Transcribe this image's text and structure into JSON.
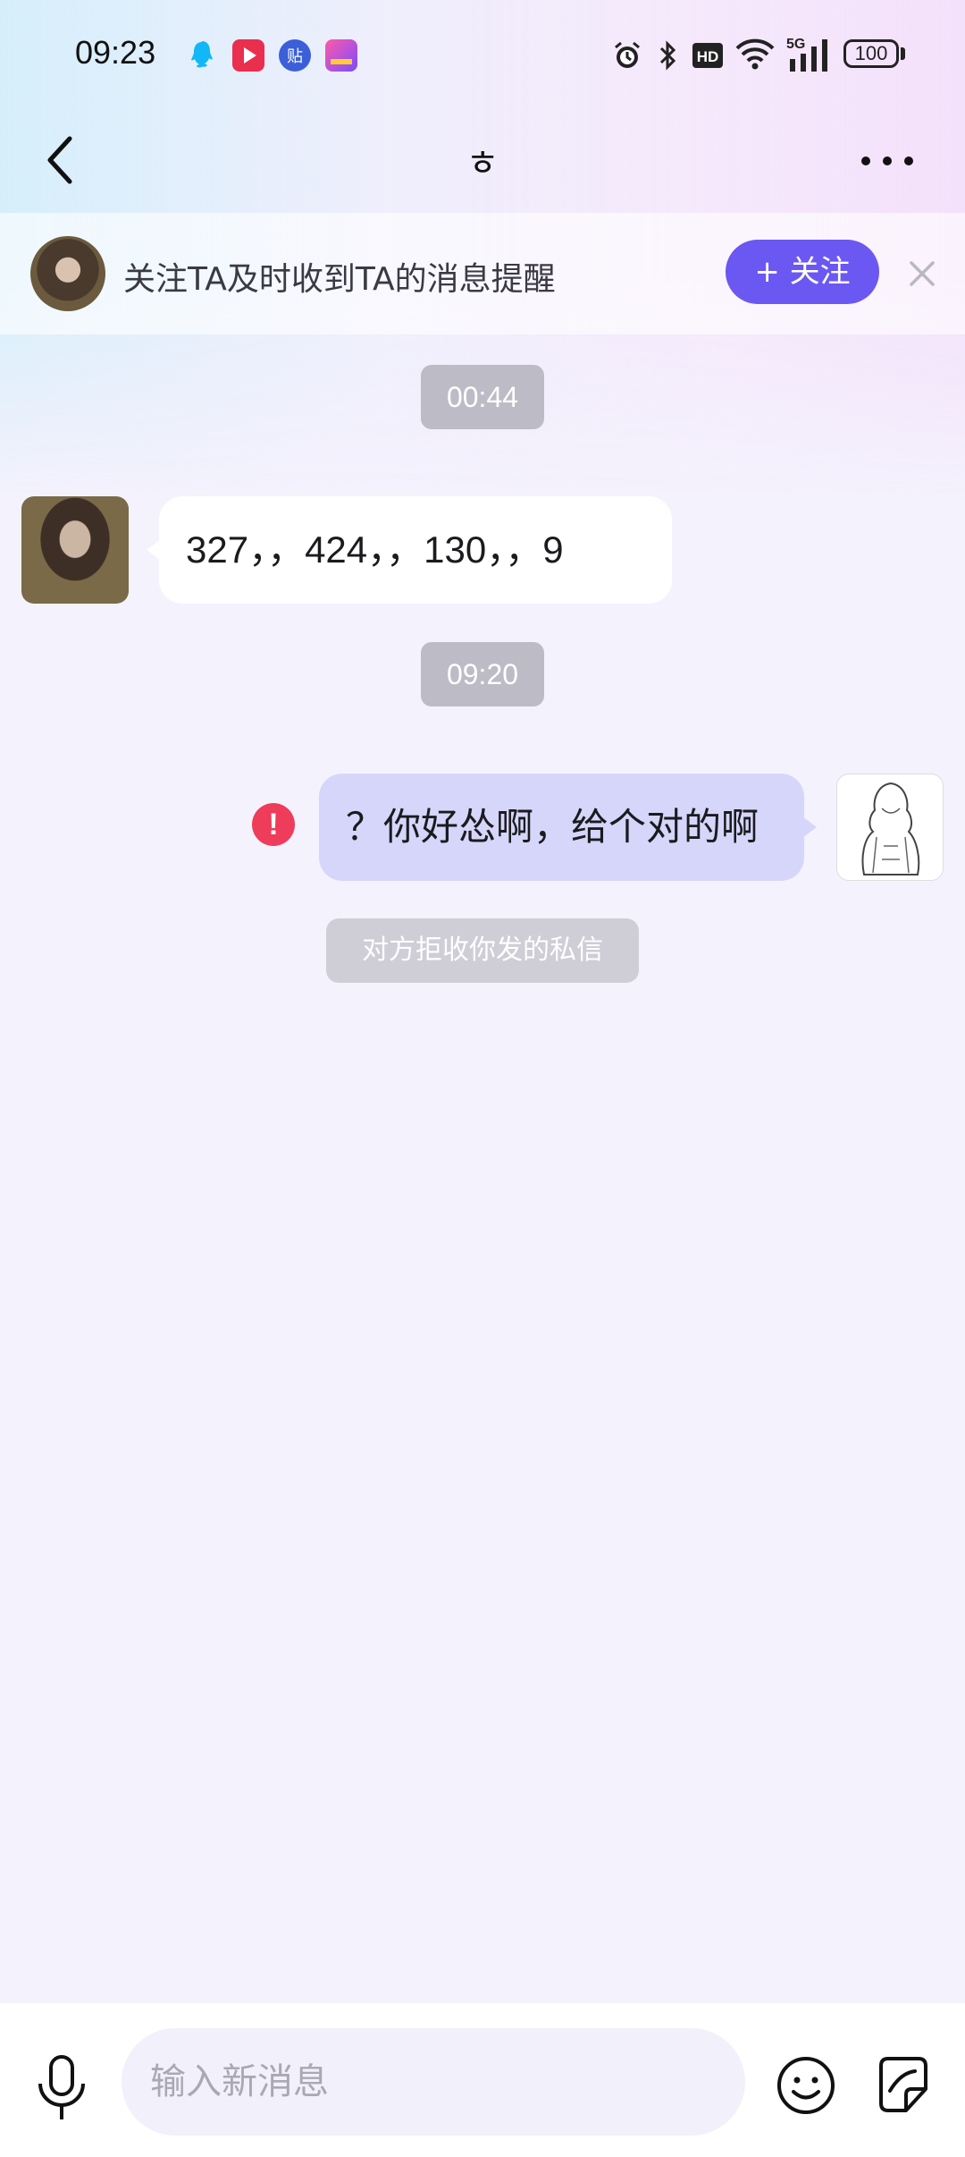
{
  "status_bar": {
    "time": "09:23",
    "battery": "100",
    "notification_icons": [
      "qq-icon",
      "video-app-icon",
      "tieba-icon",
      "rank-app-icon"
    ],
    "right_icons": [
      "alarm-icon",
      "bluetooth-icon",
      "hd-icon",
      "wifi-icon",
      "5g-signal-icon"
    ]
  },
  "nav": {
    "title": "ㅎ",
    "back_icon": "chevron-left-icon",
    "more_icon": "more-dots-icon"
  },
  "follow_banner": {
    "text": "关注TA及时收到TA的消息提醒",
    "button_label": "+ 关注",
    "close_icon": "close-icon"
  },
  "messages": {
    "time_1": "00:44",
    "incoming_text": "327，，424，，130，，9",
    "time_2": "09:20",
    "outgoing_text": "？你好怂啊，给个对的啊",
    "error_mark": "!",
    "system_notice": "对方拒收你发的私信"
  },
  "input_bar": {
    "placeholder": "输入新消息",
    "icons": [
      "microphone-icon",
      "emoji-icon",
      "sticker-icon"
    ]
  },
  "colors": {
    "accent": "#6b57f2",
    "outgoing_bubble": "#d6d6fb",
    "error": "#ee3c5a"
  }
}
